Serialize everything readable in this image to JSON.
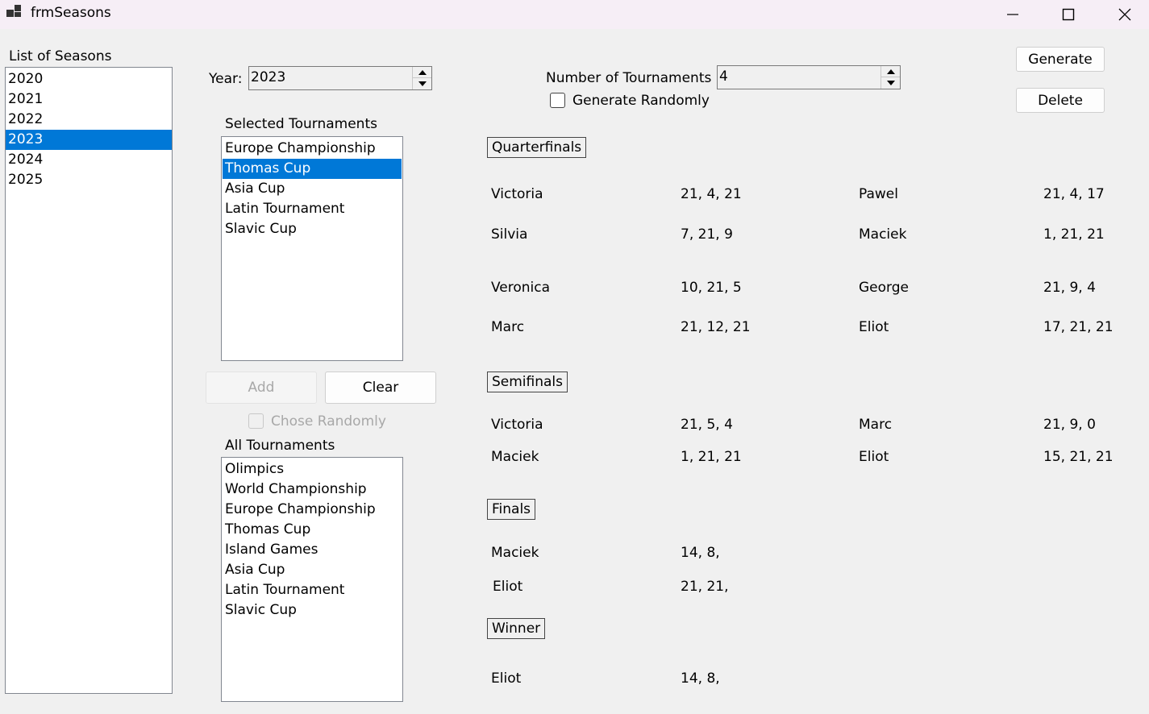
{
  "window": {
    "title": "frmSeasons",
    "controls": [
      "minimize",
      "maximize",
      "close"
    ]
  },
  "seasons": {
    "label": "List of Seasons",
    "items": [
      "2020",
      "2021",
      "2022",
      "2023",
      "2024",
      "2025"
    ],
    "selected": "2023"
  },
  "year": {
    "label": "Year:",
    "value": "2023"
  },
  "selected_tournaments": {
    "label": "Selected Tournaments",
    "items": [
      "Europe Championship",
      "Thomas Cup",
      "Asia Cup",
      "Latin Tournament",
      "Slavic Cup"
    ],
    "selected": "Thomas Cup"
  },
  "buttons": {
    "add": "Add",
    "clear": "Clear",
    "generate": "Generate",
    "delete": "Delete"
  },
  "chose_randomly": {
    "label": "Chose Randomly",
    "checked": false,
    "enabled": false
  },
  "all_tournaments": {
    "label": "All Tournaments",
    "items": [
      "Olimpics",
      "World Championship",
      "Europe Championship",
      "Thomas Cup",
      "Island Games",
      "Asia Cup",
      "Latin Tournament",
      "Slavic Cup"
    ]
  },
  "num_tournaments": {
    "label": "Number of Tournaments",
    "value": "4"
  },
  "generate_randomly": {
    "label": "Generate Randomly",
    "checked": false
  },
  "bracket": {
    "quarterfinals": {
      "label": "Quarterfinals",
      "matches": [
        {
          "p1": "Victoria",
          "s1": "21, 4, 21",
          "p2": "Pawel",
          "s2": "21, 4, 17"
        },
        {
          "p1": "Silvia",
          "s1": "7, 21, 9",
          "p2": "Maciek",
          "s2": "1, 21, 21"
        },
        {
          "p1": "Veronica",
          "s1": "10, 21, 5",
          "p2": "George",
          "s2": "21, 9, 4"
        },
        {
          "p1": "Marc",
          "s1": "21, 12, 21",
          "p2": "Eliot",
          "s2": "17, 21, 21"
        }
      ]
    },
    "semifinals": {
      "label": "Semifinals",
      "matches": [
        {
          "p1": "Victoria",
          "s1": "21, 5, 4",
          "p2": "Marc",
          "s2": "21, 9, 0"
        },
        {
          "p1": "Maciek",
          "s1": "1, 21, 21",
          "p2": "Eliot",
          "s2": "15, 21, 21"
        }
      ]
    },
    "finals": {
      "label": "Finals",
      "rows": [
        {
          "player": "Maciek",
          "score": "14, 8,"
        },
        {
          "player": "Eliot",
          "score": "21, 21,"
        }
      ]
    },
    "winner": {
      "label": "Winner",
      "player": "Eliot",
      "score": "14, 8,"
    }
  }
}
